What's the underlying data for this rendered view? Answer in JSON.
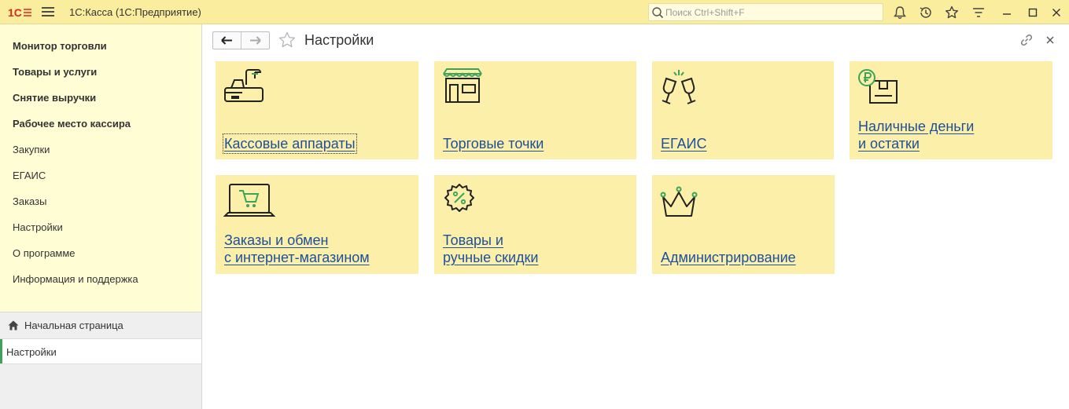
{
  "app": {
    "title": "1С:Касса  (1С:Предприятие)",
    "search_placeholder": "Поиск Ctrl+Shift+F"
  },
  "icons": {
    "logo": "1c-logo-icon",
    "menu": "hamburger-menu-icon",
    "notifications": "bell-icon",
    "history": "history-icon",
    "favorites": "star-icon",
    "functions": "funnel-menu-icon",
    "minimize": "minimize-icon",
    "maximize": "maximize-icon",
    "close": "close-icon"
  },
  "colors": {
    "titlebar": "#fbed9e",
    "sidebar": "#fffdd4",
    "tile": "#fcefaa",
    "link": "#1e4f9b",
    "accent_green": "#3da35a"
  },
  "sidebar": {
    "sections": [
      {
        "label": "Монитор торговли",
        "bold": true
      },
      {
        "label": "Товары и услуги",
        "bold": true
      },
      {
        "label": "Снятие выручки",
        "bold": true
      },
      {
        "label": "Рабочее место кассира",
        "bold": true
      },
      {
        "label": "Закупки",
        "bold": false
      },
      {
        "label": "ЕГАИС",
        "bold": false
      },
      {
        "label": "Заказы",
        "bold": false
      },
      {
        "label": "Настройки",
        "bold": false
      },
      {
        "label": "О программе",
        "bold": false
      },
      {
        "label": "Информация и поддержка",
        "bold": false
      }
    ],
    "open_windows": {
      "home": "Начальная страница",
      "active": "Настройки"
    }
  },
  "content": {
    "title": "Настройки",
    "tiles": [
      {
        "lines": [
          "Кассовые аппараты"
        ],
        "icon": "cash-register-icon"
      },
      {
        "lines": [
          "Торговые точки"
        ],
        "icon": "store-icon"
      },
      {
        "lines": [
          "ЕГАИС"
        ],
        "icon": "champagne-glasses-icon"
      },
      {
        "lines": [
          "Наличные деньги",
          "и остатки"
        ],
        "icon": "ruble-box-icon"
      },
      {
        "lines": [
          "Заказы и обмен",
          "с интернет-магазином"
        ],
        "icon": "laptop-cart-icon"
      },
      {
        "lines": [
          "Товары и",
          "ручные скидки"
        ],
        "icon": "discount-badge-icon"
      },
      {
        "lines": [
          "Администрирование"
        ],
        "icon": "crown-icon"
      }
    ]
  }
}
